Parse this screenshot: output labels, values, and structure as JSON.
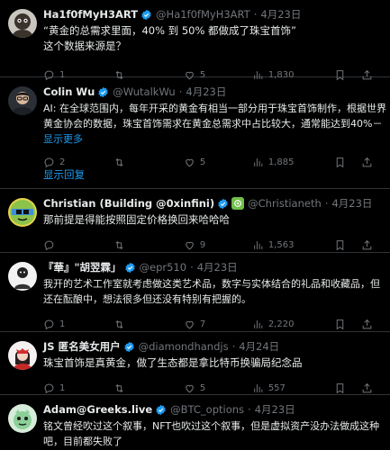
{
  "tweets": [
    {
      "name": "Ha1f0fMyH3ART",
      "handle": "@Ha1f0fMyH3ART",
      "date": "4月23日",
      "lines": [
        "“黄金的总需求里面，40% 到 50% 都做成了珠宝首饰”",
        "这个数据来源是？"
      ],
      "replies": "1",
      "retweets": "",
      "likes": "5",
      "views": "1,830"
    },
    {
      "name": "Colin Wu",
      "handle": "@WutalkWu",
      "date": "4月23日",
      "lines": [
        "AI: 在全球范围内，每年开采的黄金有相当一部分用于珠宝首饰制作，根据世界",
        "黄金协会的数据，珠宝首饰需求在黄金总需求中占比较大，通常能达到40%－"
      ],
      "show_more": "显示更多",
      "replies": "2",
      "retweets": "",
      "likes": "5",
      "views": "1,885"
    },
    {
      "name": "Christian (Building @0xinfini)",
      "handle": "@Christianeth",
      "date": "4月23日",
      "lines": [
        "那前提是得能按照固定价格换回来哈哈哈"
      ],
      "replies": "",
      "retweets": "",
      "likes": "9",
      "views": "1,563"
    },
    {
      "name": "『華』\"胡翌霖」",
      "handle": "@epr510",
      "date": "4月23日",
      "lines": [
        "我开的艺术工作室就考虑做这类艺术品，数字与实体结合的礼品和收藏品，但",
        "还在酝酿中，想法很多但还没有特别有把握的。"
      ],
      "replies": "1",
      "retweets": "",
      "likes": "7",
      "views": "2,220"
    },
    {
      "name": "JS 匿名美女用户",
      "handle": "@diamondhandjs",
      "date": "4月24日",
      "lines": [
        "珠宝首饰是真黄金，做了生态都是拿比特币换骗局纪念品"
      ],
      "replies": "1",
      "retweets": "",
      "likes": "5",
      "views": "557"
    },
    {
      "name": "Adam@Greeks.live",
      "handle": "@BTC_options",
      "date": "4月23日",
      "lines": [
        "铭文曾经吹过这个叙事，NFT也吹过这个叙事，但是虚拟资产没办法做成这种",
        "吧，目前都失败了"
      ],
      "replies": "",
      "retweets": "",
      "likes": "",
      "views": ""
    }
  ],
  "show_replies": "显示回复",
  "separator": "·",
  "colors": {
    "background": "#000000",
    "text": "#e7e9ea",
    "secondary": "#71767b",
    "accent": "#1d9bf0",
    "border": "#2f3336"
  },
  "icons": [
    "verified-badge-icon",
    "reply-icon",
    "retweet-icon",
    "like-icon",
    "views-icon",
    "bookmark-icon",
    "share-icon",
    "affiliate-badge-icon"
  ]
}
